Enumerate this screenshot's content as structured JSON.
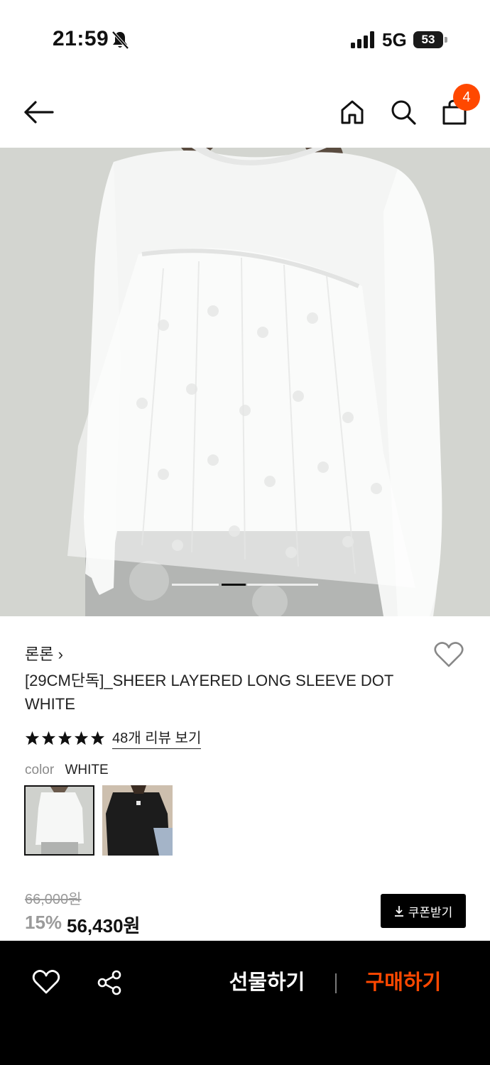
{
  "status_bar": {
    "time": "21:59",
    "network": "5G",
    "battery": "53"
  },
  "header": {
    "cart_count": "4"
  },
  "icons": {
    "back": "arrow-left-icon",
    "home": "home-icon",
    "search": "search-icon",
    "cart": "shopping-bag-icon",
    "wishlist": "heart-icon",
    "share": "share-icon",
    "coupon": "download-icon",
    "rating": "star-icon"
  },
  "gallery": {
    "slide_count": 3,
    "active_slide": 2
  },
  "product": {
    "brand": "론론 ›",
    "title": "[29CM단독]_SHEER LAYERED LONG SLEEVE DOT WHITE",
    "rating_stars": 5,
    "review_link": "48개 리뷰 보기",
    "color_label": "color",
    "color_value": "WHITE",
    "color_options": [
      {
        "name": "white-swatch",
        "selected": true
      },
      {
        "name": "black-swatch",
        "selected": false
      }
    ],
    "original_price": "66,000원",
    "discount_rate": "15%",
    "sale_price": "56,430원",
    "coupon_label": "쿠폰받기"
  },
  "bottom_bar": {
    "gift_label": "선물하기",
    "buy_label": "구매하기"
  },
  "colors": {
    "accent": "#ff4800",
    "bottom_bar_bg": "#000000",
    "muted_text": "#9a9a9a"
  }
}
